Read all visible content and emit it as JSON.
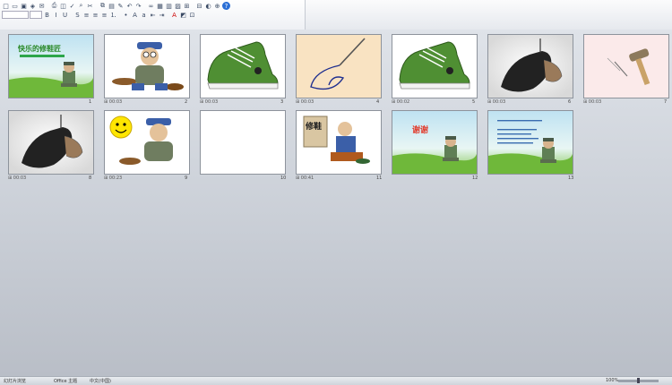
{
  "toolbar": {
    "row1_icons": [
      "new-icon",
      "open-icon",
      "save-icon",
      "permission-icon",
      "email-icon",
      "print-icon",
      "print-preview-icon",
      "spelling-icon",
      "research-icon",
      "cut-icon",
      "copy-icon",
      "paste-icon",
      "format-painter-icon",
      "undo-icon",
      "redo-icon",
      "hyperlink-icon",
      "table-icon",
      "chart-icon",
      "insert-picture-icon",
      "expand-icon",
      "collapse-icon",
      "grayscale-icon",
      "zoom-icon",
      "help-icon"
    ],
    "row2_icons": [
      "font-name-box",
      "font-size-box",
      "bold-icon",
      "italic-icon",
      "underline-icon",
      "shadow-icon",
      "align-left-icon",
      "center-icon",
      "align-right-icon",
      "numbering-icon",
      "bullets-icon",
      "increase-font-icon",
      "decrease-font-icon",
      "decrease-indent-icon",
      "increase-indent-icon",
      "font-color-icon",
      "design-icon",
      "new-slide-icon"
    ]
  },
  "slides": [
    {
      "number": "1",
      "title_text": "快乐的修鞋匠",
      "theme": "green",
      "meta": ""
    },
    {
      "number": "2",
      "meta": "00:03",
      "theme": "cobbler"
    },
    {
      "number": "3",
      "meta": "00:03",
      "theme": "sneaker"
    },
    {
      "number": "4",
      "meta": "00:03",
      "theme": "needle"
    },
    {
      "number": "5",
      "meta": "00:02",
      "theme": "sneaker"
    },
    {
      "number": "6",
      "meta": "00:03",
      "theme": "darkshoe"
    },
    {
      "number": "7",
      "meta": "00:03",
      "theme": "hammer"
    },
    {
      "number": "8",
      "meta": "00:03",
      "theme": "darkshoe"
    },
    {
      "number": "9",
      "meta": "00:23",
      "theme": "smiley"
    },
    {
      "number": "10",
      "meta": "",
      "theme": "blank"
    },
    {
      "number": "11",
      "meta": "00:41",
      "theme": "repair",
      "title_text": "修鞋"
    },
    {
      "number": "12",
      "meta": "",
      "theme": "thanks",
      "title_text": "谢谢"
    },
    {
      "number": "13",
      "meta": "",
      "theme": "textgreen"
    }
  ],
  "status": {
    "view_label": "幻灯片浏览",
    "theme_label": "Office 主题",
    "lang_label": "中文(中国)",
    "zoom": "100%"
  }
}
